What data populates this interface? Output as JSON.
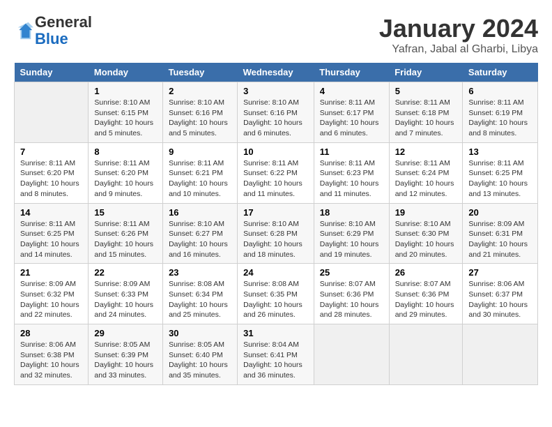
{
  "header": {
    "logo_line1": "General",
    "logo_line2": "Blue",
    "month": "January 2024",
    "location": "Yafran, Jabal al Gharbi, Libya"
  },
  "days_of_week": [
    "Sunday",
    "Monday",
    "Tuesday",
    "Wednesday",
    "Thursday",
    "Friday",
    "Saturday"
  ],
  "weeks": [
    [
      {
        "day": "",
        "info": ""
      },
      {
        "day": "1",
        "info": "Sunrise: 8:10 AM\nSunset: 6:15 PM\nDaylight: 10 hours\nand 5 minutes."
      },
      {
        "day": "2",
        "info": "Sunrise: 8:10 AM\nSunset: 6:16 PM\nDaylight: 10 hours\nand 5 minutes."
      },
      {
        "day": "3",
        "info": "Sunrise: 8:10 AM\nSunset: 6:16 PM\nDaylight: 10 hours\nand 6 minutes."
      },
      {
        "day": "4",
        "info": "Sunrise: 8:11 AM\nSunset: 6:17 PM\nDaylight: 10 hours\nand 6 minutes."
      },
      {
        "day": "5",
        "info": "Sunrise: 8:11 AM\nSunset: 6:18 PM\nDaylight: 10 hours\nand 7 minutes."
      },
      {
        "day": "6",
        "info": "Sunrise: 8:11 AM\nSunset: 6:19 PM\nDaylight: 10 hours\nand 8 minutes."
      }
    ],
    [
      {
        "day": "7",
        "info": "Sunrise: 8:11 AM\nSunset: 6:20 PM\nDaylight: 10 hours\nand 8 minutes."
      },
      {
        "day": "8",
        "info": "Sunrise: 8:11 AM\nSunset: 6:20 PM\nDaylight: 10 hours\nand 9 minutes."
      },
      {
        "day": "9",
        "info": "Sunrise: 8:11 AM\nSunset: 6:21 PM\nDaylight: 10 hours\nand 10 minutes."
      },
      {
        "day": "10",
        "info": "Sunrise: 8:11 AM\nSunset: 6:22 PM\nDaylight: 10 hours\nand 11 minutes."
      },
      {
        "day": "11",
        "info": "Sunrise: 8:11 AM\nSunset: 6:23 PM\nDaylight: 10 hours\nand 11 minutes."
      },
      {
        "day": "12",
        "info": "Sunrise: 8:11 AM\nSunset: 6:24 PM\nDaylight: 10 hours\nand 12 minutes."
      },
      {
        "day": "13",
        "info": "Sunrise: 8:11 AM\nSunset: 6:25 PM\nDaylight: 10 hours\nand 13 minutes."
      }
    ],
    [
      {
        "day": "14",
        "info": "Sunrise: 8:11 AM\nSunset: 6:25 PM\nDaylight: 10 hours\nand 14 minutes."
      },
      {
        "day": "15",
        "info": "Sunrise: 8:11 AM\nSunset: 6:26 PM\nDaylight: 10 hours\nand 15 minutes."
      },
      {
        "day": "16",
        "info": "Sunrise: 8:10 AM\nSunset: 6:27 PM\nDaylight: 10 hours\nand 16 minutes."
      },
      {
        "day": "17",
        "info": "Sunrise: 8:10 AM\nSunset: 6:28 PM\nDaylight: 10 hours\nand 18 minutes."
      },
      {
        "day": "18",
        "info": "Sunrise: 8:10 AM\nSunset: 6:29 PM\nDaylight: 10 hours\nand 19 minutes."
      },
      {
        "day": "19",
        "info": "Sunrise: 8:10 AM\nSunset: 6:30 PM\nDaylight: 10 hours\nand 20 minutes."
      },
      {
        "day": "20",
        "info": "Sunrise: 8:09 AM\nSunset: 6:31 PM\nDaylight: 10 hours\nand 21 minutes."
      }
    ],
    [
      {
        "day": "21",
        "info": "Sunrise: 8:09 AM\nSunset: 6:32 PM\nDaylight: 10 hours\nand 22 minutes."
      },
      {
        "day": "22",
        "info": "Sunrise: 8:09 AM\nSunset: 6:33 PM\nDaylight: 10 hours\nand 24 minutes."
      },
      {
        "day": "23",
        "info": "Sunrise: 8:08 AM\nSunset: 6:34 PM\nDaylight: 10 hours\nand 25 minutes."
      },
      {
        "day": "24",
        "info": "Sunrise: 8:08 AM\nSunset: 6:35 PM\nDaylight: 10 hours\nand 26 minutes."
      },
      {
        "day": "25",
        "info": "Sunrise: 8:07 AM\nSunset: 6:36 PM\nDaylight: 10 hours\nand 28 minutes."
      },
      {
        "day": "26",
        "info": "Sunrise: 8:07 AM\nSunset: 6:36 PM\nDaylight: 10 hours\nand 29 minutes."
      },
      {
        "day": "27",
        "info": "Sunrise: 8:06 AM\nSunset: 6:37 PM\nDaylight: 10 hours\nand 30 minutes."
      }
    ],
    [
      {
        "day": "28",
        "info": "Sunrise: 8:06 AM\nSunset: 6:38 PM\nDaylight: 10 hours\nand 32 minutes."
      },
      {
        "day": "29",
        "info": "Sunrise: 8:05 AM\nSunset: 6:39 PM\nDaylight: 10 hours\nand 33 minutes."
      },
      {
        "day": "30",
        "info": "Sunrise: 8:05 AM\nSunset: 6:40 PM\nDaylight: 10 hours\nand 35 minutes."
      },
      {
        "day": "31",
        "info": "Sunrise: 8:04 AM\nSunset: 6:41 PM\nDaylight: 10 hours\nand 36 minutes."
      },
      {
        "day": "",
        "info": ""
      },
      {
        "day": "",
        "info": ""
      },
      {
        "day": "",
        "info": ""
      }
    ]
  ]
}
